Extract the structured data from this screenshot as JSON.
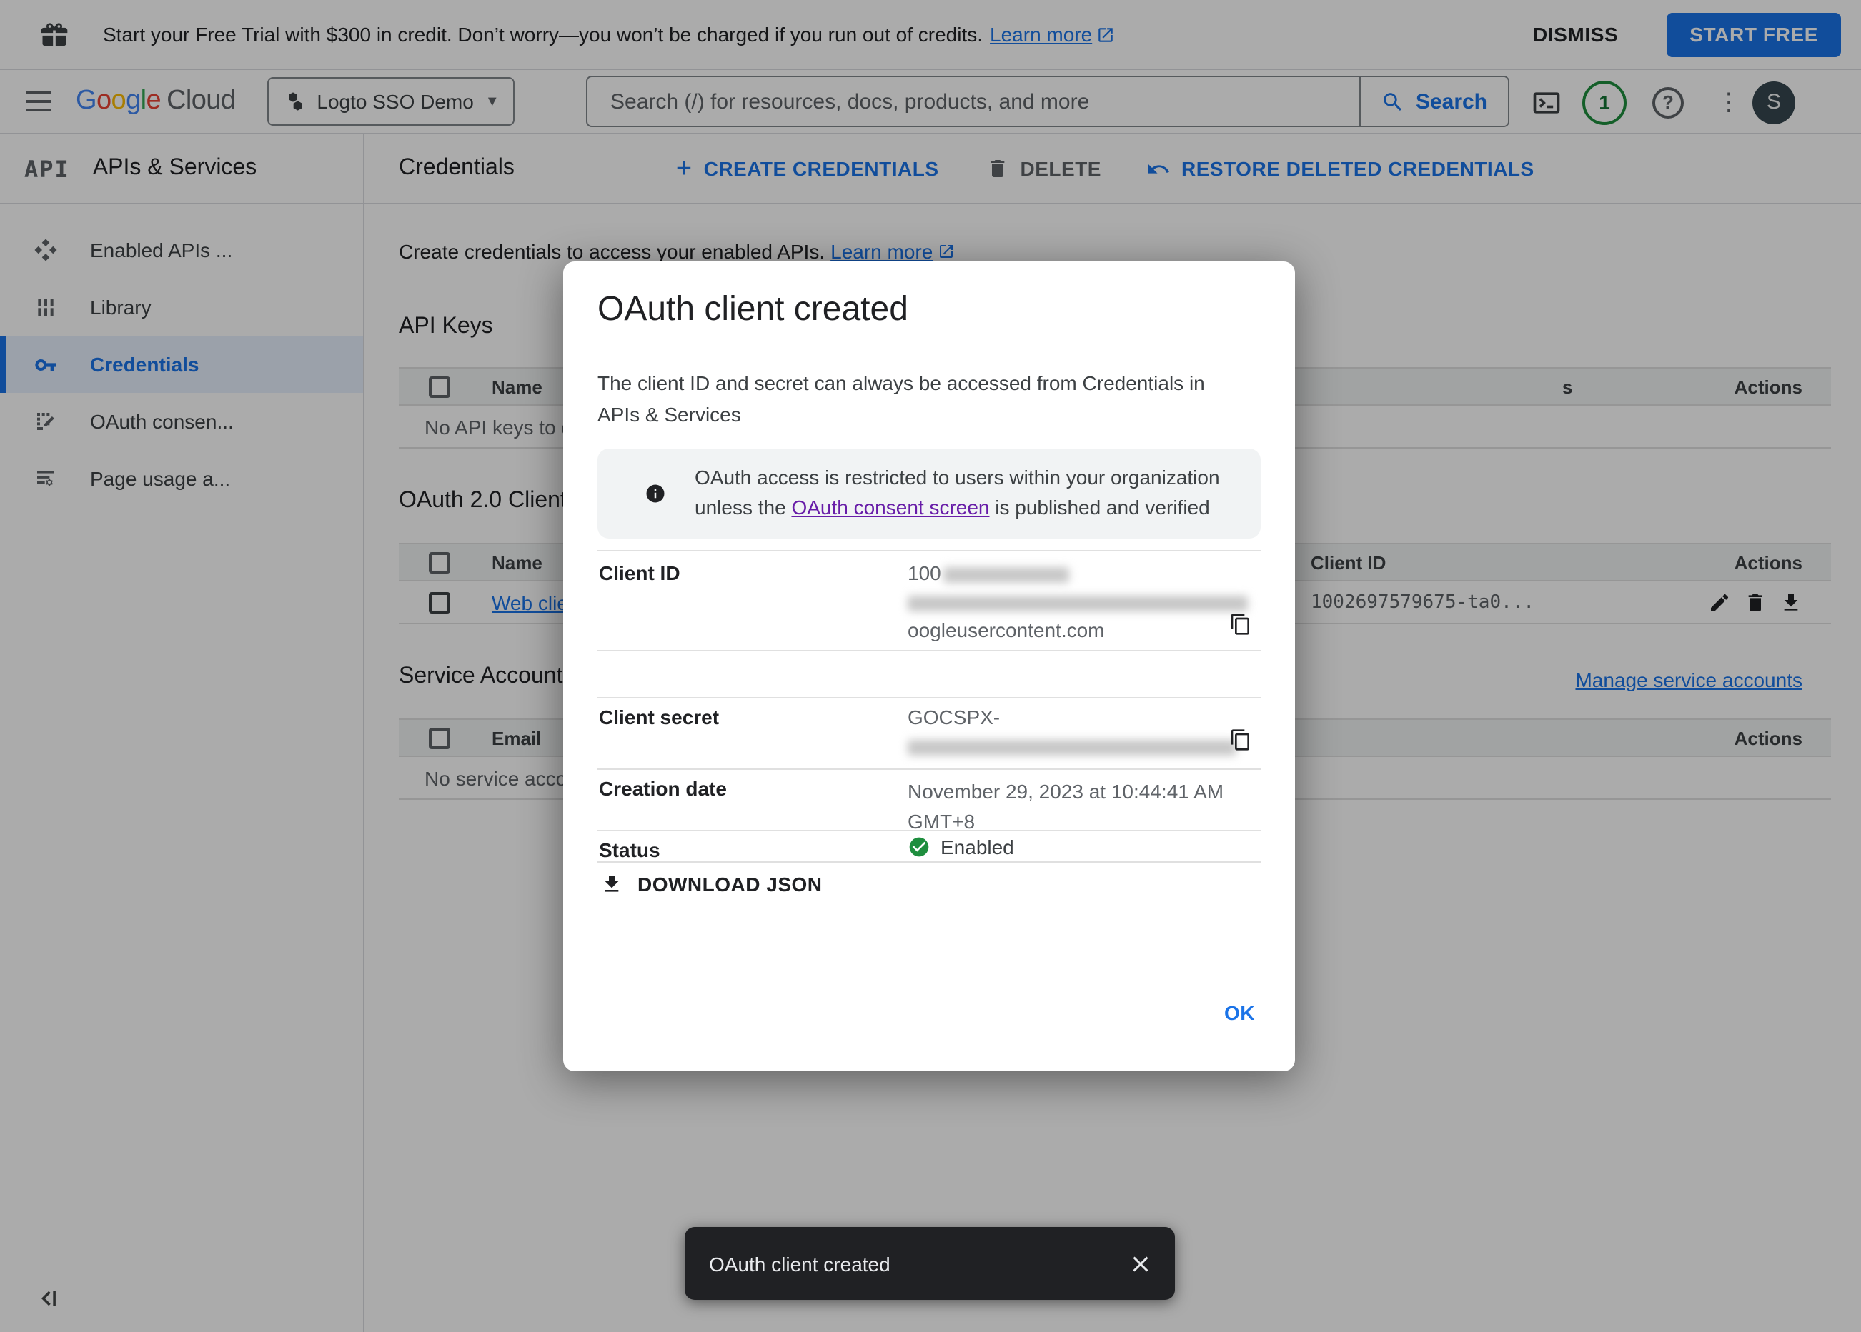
{
  "colors": {
    "accent": "#1a73e8",
    "visited_link": "#681da8",
    "success": "#1e8e3e",
    "toast_bg": "#202124",
    "selected_bg": "#e8f0fe"
  },
  "banner": {
    "text": "Start your Free Trial with $300 in credit. Don’t worry—you won’t be charged if you run out of credits.",
    "learn_more": "Learn more",
    "dismiss": "DISMISS",
    "start_free": "START FREE"
  },
  "header": {
    "logo_google": "Google",
    "logo_cloud": "Cloud",
    "project_name": "Logto SSO Demo",
    "search_placeholder": "Search (/) for resources, docs, products, and more",
    "search_button": "Search",
    "notification_count": "1",
    "help_glyph": "?",
    "avatar_initial": "S"
  },
  "sidebar": {
    "product_logo": "API",
    "title": "APIs & Services",
    "items": [
      {
        "label": "Enabled APIs ...",
        "icon": "dashboard-icon",
        "selected": false
      },
      {
        "label": "Library",
        "icon": "library-icon",
        "selected": false
      },
      {
        "label": "Credentials",
        "icon": "key-icon",
        "selected": true
      },
      {
        "label": "OAuth consen...",
        "icon": "consent-icon",
        "selected": false
      },
      {
        "label": "Page usage a...",
        "icon": "page-usage-icon",
        "selected": false
      }
    ]
  },
  "toolbar": {
    "title": "Credentials",
    "create": "CREATE CREDENTIALS",
    "delete": "DELETE",
    "restore": "RESTORE DELETED CREDENTIALS"
  },
  "content": {
    "intro": "Create credentials to access your enabled APIs.",
    "intro_link": "Learn more",
    "api_keys": {
      "heading": "API Keys",
      "col_name": "Name",
      "col_tail_fragment": "s",
      "col_actions": "Actions",
      "empty": "No API keys to display"
    },
    "oauth_clients": {
      "heading": "OAuth 2.0 Client IDs",
      "col_name": "Name",
      "col_client_id": "Client ID",
      "col_actions": "Actions",
      "row_name": "Web client 1",
      "row_client_id": "1002697579675-ta0..."
    },
    "service_accounts": {
      "heading": "Service Accounts",
      "manage_link": "Manage service accounts",
      "col_email": "Email",
      "col_actions": "Actions",
      "empty": "No service accounts to display"
    }
  },
  "dialog": {
    "title": "OAuth client created",
    "description": "The client ID and secret can always be accessed from Credentials in APIs & Services",
    "info_pre": "OAuth access is restricted to users within your organization unless the ",
    "info_link": "OAuth consent screen",
    "info_post": " is published and verified",
    "client_id_label": "Client ID",
    "client_id_visible_prefix": "100",
    "client_id_visible_suffix": "oogleusercontent.com",
    "client_secret_label": "Client secret",
    "client_secret_visible_prefix": "GOCSPX-",
    "creation_date_label": "Creation date",
    "creation_date_value": "November 29, 2023 at 10:44:41 AM GMT+8",
    "status_label": "Status",
    "status_value": "Enabled",
    "download_json": "DOWNLOAD JSON",
    "ok": "OK"
  },
  "toast": {
    "message": "OAuth client created"
  }
}
